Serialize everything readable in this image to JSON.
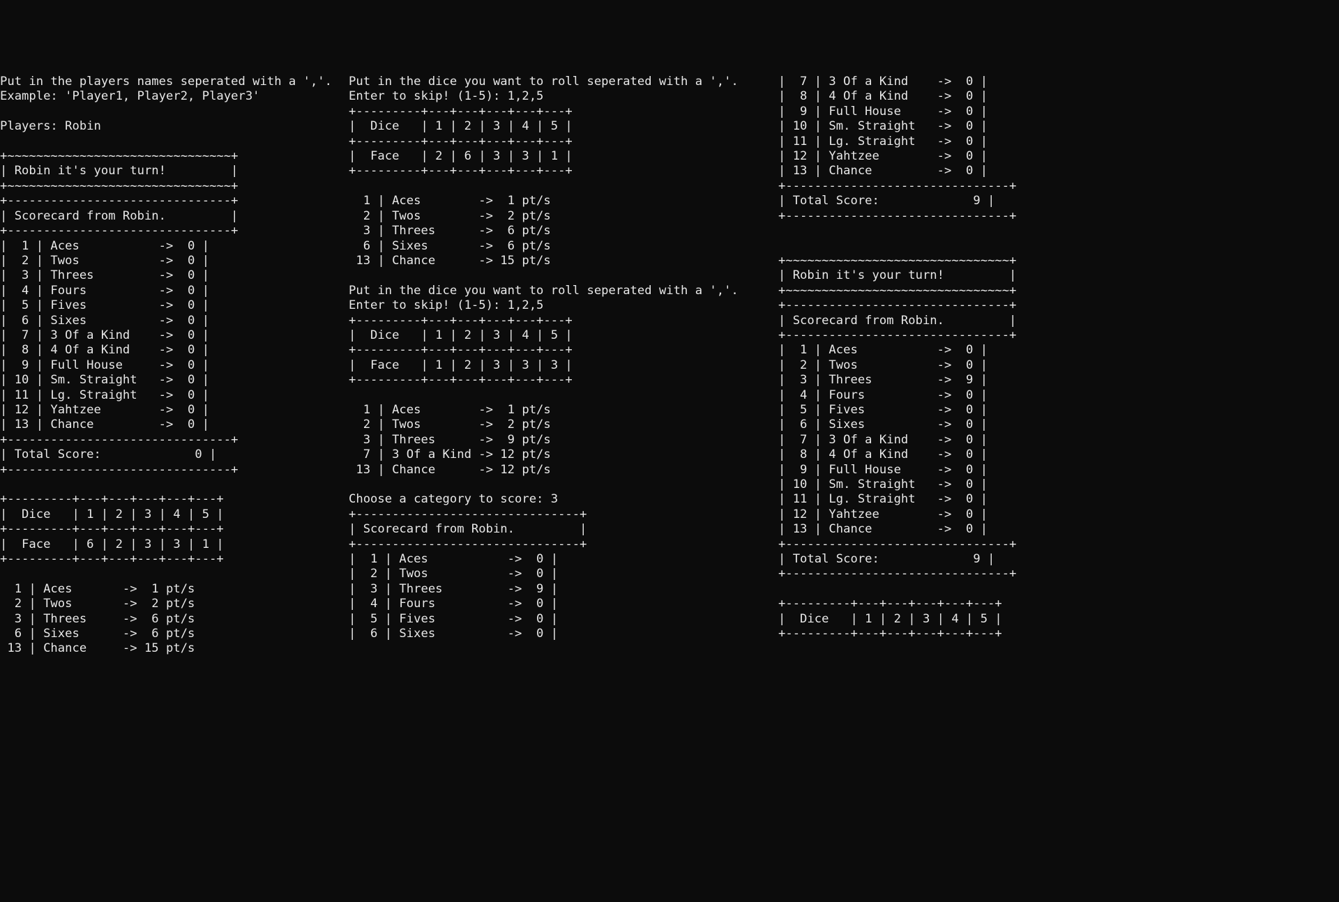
{
  "text": {
    "intro1": "Put in the players names seperated with a ','.",
    "intro2": "Example: 'Player1, Player2, Player3'",
    "blank": "",
    "playersLine": "Players: Robin",
    "turnBanner": "| Robin it's your turn!         |",
    "tilde33": "+~~~~~~~~~~~~~~~~~~~~~~~~~~~~~~~+",
    "scorecardHeader": "| Scorecard from Robin.         |",
    "dash33": "+-------------------------------+",
    "scRow1_0": "|  1 | Aces           ->  0 |",
    "scRow2_0": "|  2 | Twos           ->  0 |",
    "scRow3_0": "|  3 | Threes         ->  0 |",
    "scRow4_0": "|  4 | Fours          ->  0 |",
    "scRow5_0": "|  5 | Fives          ->  0 |",
    "scRow6_0": "|  6 | Sixes          ->  0 |",
    "scRow7_0": "|  7 | 3 Of a Kind    ->  0 |",
    "scRow8_0": "|  8 | 4 Of a Kind    ->  0 |",
    "scRow9_0": "|  9 | Full House     ->  0 |",
    "scRow10_0": "| 10 | Sm. Straight   ->  0 |",
    "scRow11_0": "| 11 | Lg. Straight   ->  0 |",
    "scRow12_0": "| 12 | Yahtzee        ->  0 |",
    "scRow13_0": "| 13 | Chance         ->  0 |",
    "totalScore0": "| Total Score:             0 |",
    "diceBorder": "+---------+---+---+---+---+---+",
    "diceHeader": "|  Dice   | 1 | 2 | 3 | 4 | 5 |",
    "face_62331": "|  Face   | 6 | 2 | 3 | 3 | 1 |",
    "face_26331": "|  Face   | 2 | 6 | 3 | 3 | 1 |",
    "face_12333": "|  Face   | 1 | 2 | 3 | 3 | 3 |",
    "ptsA_1": "  1 | Aces       ->  1 pt/s",
    "ptsA_2": "  2 | Twos       ->  2 pt/s",
    "ptsA_3": "  3 | Threes     ->  6 pt/s",
    "ptsA_6": "  6 | Sixes      ->  6 pt/s",
    "ptsA_13": " 13 | Chance     -> 15 pt/s",
    "rerollPrompt1": "Put in the dice you want to roll seperated with a ','.",
    "rerollPrompt2": "Enter to skip! (1-5): 1,2,5",
    "ptsB_1": "  1 | Aces        ->  1 pt/s",
    "ptsB_2": "  2 | Twos        ->  2 pt/s",
    "ptsB_3": "  3 | Threes      ->  6 pt/s",
    "ptsB_6": "  6 | Sixes       ->  6 pt/s",
    "ptsB_13": " 13 | Chance      -> 15 pt/s",
    "ptsC_1": "  1 | Aces        ->  1 pt/s",
    "ptsC_2": "  2 | Twos        ->  2 pt/s",
    "ptsC_3": "  3 | Threes      ->  9 pt/s",
    "ptsC_7": "  7 | 3 Of a Kind -> 12 pt/s",
    "ptsC_13": " 13 | Chance      -> 12 pt/s",
    "choosePrompt": "Choose a category to score: 3",
    "sc2_1": "|  1 | Aces           ->  0 |",
    "sc2_2": "|  2 | Twos           ->  0 |",
    "sc2_3": "|  3 | Threes         ->  9 |",
    "sc2_4": "|  4 | Fours          ->  0 |",
    "sc2_5": "|  5 | Fives          ->  0 |",
    "sc2_6": "|  6 | Sixes          ->  0 |",
    "sc2_7": "|  7 | 3 Of a Kind    ->  0 |",
    "sc2_8": "|  8 | 4 Of a Kind    ->  0 |",
    "sc2_9": "|  9 | Full House     ->  0 |",
    "sc2_10": "| 10 | Sm. Straight   ->  0 |",
    "sc2_11": "| 11 | Lg. Straight   ->  0 |",
    "sc2_12": "| 12 | Yahtzee        ->  0 |",
    "sc2_13": "| 13 | Chance         ->  0 |",
    "totalScore9": "| Total Score:             9 |"
  }
}
